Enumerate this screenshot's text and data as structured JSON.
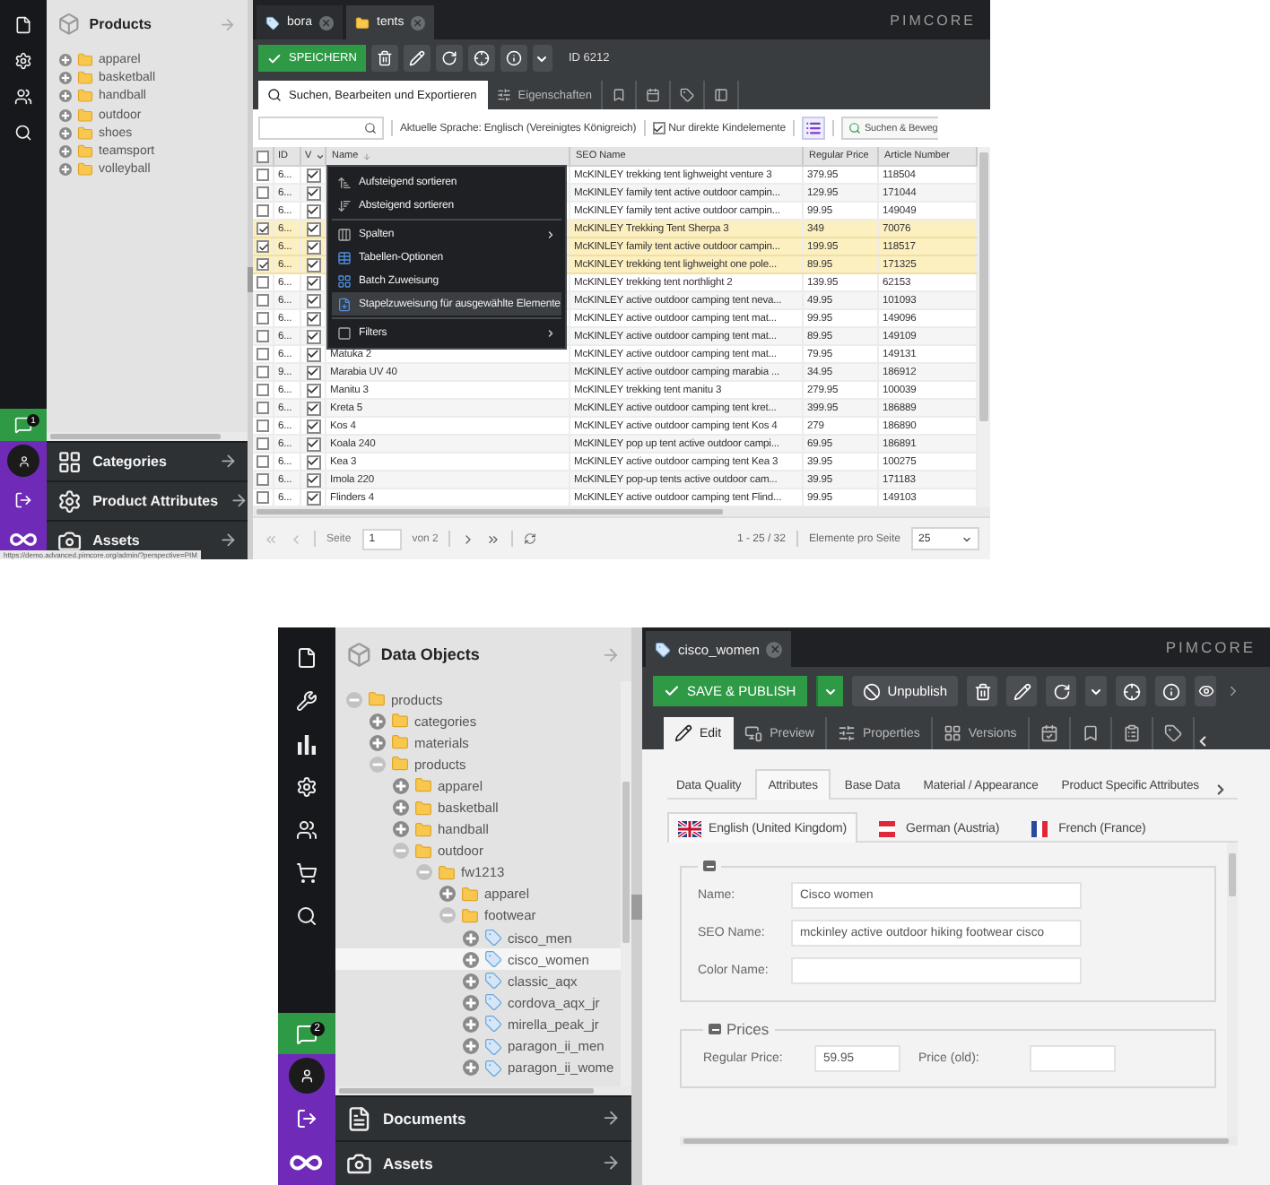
{
  "grid_view": {
    "rail": {
      "chat_badge": "1"
    },
    "tree_panel": {
      "title": "Products",
      "items": [
        {
          "label": "apparel",
          "kind": "folder",
          "expanded": false
        },
        {
          "label": "basketball",
          "kind": "folder",
          "expanded": false
        },
        {
          "label": "handball",
          "kind": "folder",
          "expanded": false
        },
        {
          "label": "outdoor",
          "kind": "folder",
          "expanded": false
        },
        {
          "label": "shoes",
          "kind": "folder",
          "expanded": false
        },
        {
          "label": "teamsport",
          "kind": "folder",
          "expanded": false
        },
        {
          "label": "volleyball",
          "kind": "folder",
          "expanded": false
        }
      ]
    },
    "accordions": [
      {
        "label": "Categories"
      },
      {
        "label": "Product Attributes"
      },
      {
        "label": "Assets"
      }
    ],
    "status_url": "https://demo.advanced.pimcore.org/admin/?perspective=PIM",
    "doc_tabs": [
      {
        "label": "bora",
        "kind": "object",
        "selected": false
      },
      {
        "label": "tents",
        "kind": "folder",
        "selected": true
      }
    ],
    "logo": "PIMCORE",
    "toolbar": {
      "save_label": "SPEICHERN",
      "id_label": "ID 6212"
    },
    "view_tabs": [
      {
        "label": "Suchen, Bearbeiten und Exportieren",
        "selected": true
      },
      {
        "label": "Eigenschaften",
        "selected": false
      },
      {
        "selected": false
      },
      {
        "selected": false
      },
      {
        "selected": false
      },
      {
        "selected": false
      }
    ],
    "filter_bar": {
      "language": "Aktuelle Sprache: Englisch (Vereinigtes Königreich)",
      "direct_children": {
        "label": "Nur direkte Kindelemente",
        "checked": true
      },
      "search_button": "Suchen & Beweg"
    },
    "table": {
      "all_checked": false,
      "columns": [
        "ID",
        "V",
        "Name",
        "SEO Name",
        "Regular Price",
        "Article Number"
      ],
      "rows": [
        {
          "checked": false,
          "selected": false,
          "id": "6...",
          "published": true,
          "seo_name": "McKINLEY trekking tent lighweight venture 3",
          "price": "379.95",
          "article": "118504"
        },
        {
          "checked": false,
          "selected": false,
          "id": "6...",
          "published": true,
          "seo_name": "McKINLEY family tent active outdoor campin...",
          "price": "129.95",
          "article": "171044"
        },
        {
          "checked": false,
          "selected": false,
          "id": "6...",
          "published": true,
          "seo_name": "McKINLEY family tent active outdoor campin...",
          "price": "99.95",
          "article": "149049"
        },
        {
          "checked": true,
          "selected": true,
          "id": "6...",
          "published": true,
          "seo_name": "McKINLEY Trekking Tent Sherpa 3",
          "price": "349",
          "article": "70076"
        },
        {
          "checked": true,
          "selected": true,
          "id": "6...",
          "published": true,
          "seo_name": "McKINLEY family tent active outdoor campin...",
          "price": "199.95",
          "article": "118517"
        },
        {
          "checked": true,
          "selected": true,
          "id": "6...",
          "published": true,
          "seo_name": "McKINLEY trekking tent lighweight one pole...",
          "price": "89.95",
          "article": "171325"
        },
        {
          "checked": false,
          "selected": false,
          "id": "6...",
          "published": true,
          "seo_name": "McKINLEY trekking tent northlight 2",
          "price": "139.95",
          "article": "62153"
        },
        {
          "checked": false,
          "selected": false,
          "id": "6...",
          "published": true,
          "seo_name": "McKINLEY active outdoor camping tent neva...",
          "price": "49.95",
          "article": "101093"
        },
        {
          "checked": false,
          "selected": false,
          "id": "6...",
          "published": true,
          "seo_name": "McKINLEY active outdoor camping tent mat...",
          "price": "99.95",
          "article": "149096"
        },
        {
          "checked": false,
          "selected": false,
          "id": "6...",
          "published": true,
          "seo_name": "McKINLEY active outdoor camping tent mat...",
          "price": "89.95",
          "article": "149109"
        },
        {
          "checked": false,
          "selected": false,
          "id": "6...",
          "published": true,
          "name": "Matuka 2",
          "seo_name": "McKINLEY active outdoor camping tent mat...",
          "price": "79.95",
          "article": "149131"
        },
        {
          "checked": false,
          "selected": false,
          "id": "9...",
          "published": true,
          "name": "Marabia UV 40",
          "seo_name": "McKINLEY active outdoor camping marabia ...",
          "price": "34.95",
          "article": "186912"
        },
        {
          "checked": false,
          "selected": false,
          "id": "6...",
          "published": true,
          "name": "Manitu 3",
          "seo_name": "McKINLEY trekking tent manitu 3",
          "price": "279.95",
          "article": "100039"
        },
        {
          "checked": false,
          "selected": false,
          "id": "6...",
          "published": true,
          "name": "Kreta 5",
          "seo_name": "McKINLEY active outdoor camping tent kret...",
          "price": "399.95",
          "article": "186889"
        },
        {
          "checked": false,
          "selected": false,
          "id": "6...",
          "published": true,
          "name": "Kos 4",
          "seo_name": "McKINLEY active outdoor camping tent Kos 4",
          "price": "279",
          "article": "186890"
        },
        {
          "checked": false,
          "selected": false,
          "id": "6...",
          "published": true,
          "name": "Koala 240",
          "seo_name": "McKINLEY pop up tent active outdoor campi...",
          "price": "69.95",
          "article": "186891"
        },
        {
          "checked": false,
          "selected": false,
          "id": "6...",
          "published": true,
          "name": "Kea 3",
          "seo_name": "McKINLEY active outdoor camping tent Kea 3",
          "price": "39.95",
          "article": "100275"
        },
        {
          "checked": false,
          "selected": false,
          "id": "6...",
          "published": true,
          "name": "Imola 220",
          "seo_name": "McKINLEY pop-up tents active outdoor cam...",
          "price": "39.95",
          "article": "171183"
        },
        {
          "checked": false,
          "selected": false,
          "id": "6...",
          "published": true,
          "name": "Flinders 4",
          "seo_name": "McKINLEY active outdoor camping tent Flind...",
          "price": "99.95",
          "article": "149103"
        }
      ]
    },
    "context_menu": {
      "items": [
        {
          "label": "Aufsteigend sortieren",
          "selected": false
        },
        {
          "label": "Absteigend sortieren",
          "selected": false
        },
        {
          "label": "Spalten",
          "submenu": true,
          "divider_before": true,
          "selected": false
        },
        {
          "label": "Tabellen-Optionen",
          "selected": false
        },
        {
          "label": "Batch Zuweisung",
          "selected": false
        },
        {
          "label": "Stapelzuweisung für ausgewählte Elemente",
          "selected": true
        },
        {
          "label": "Filters",
          "submenu": true,
          "divider_before": true,
          "selected": false
        }
      ]
    },
    "pager": {
      "page_label": "Seite",
      "page": "1",
      "of": "von 2",
      "range": "1 - 25 / 32",
      "per_page_label": "Elemente pro Seite",
      "per_page": "25"
    }
  },
  "object_editor": {
    "rail": {
      "chat_badge": "2"
    },
    "tree_panel": {
      "title": "Data Objects",
      "items": [
        {
          "label": "products",
          "kind": "folder",
          "expanded": true,
          "selected": false,
          "children": [
            {
              "label": "categories",
              "kind": "folder",
              "expanded": false,
              "selected": false
            },
            {
              "label": "materials",
              "kind": "folder",
              "expanded": false,
              "selected": false
            },
            {
              "label": "products",
              "kind": "folder",
              "expanded": true,
              "selected": false,
              "children": [
                {
                  "label": "apparel",
                  "kind": "folder",
                  "expanded": false,
                  "selected": false
                },
                {
                  "label": "basketball",
                  "kind": "folder",
                  "expanded": false,
                  "selected": false
                },
                {
                  "label": "handball",
                  "kind": "folder",
                  "expanded": false,
                  "selected": false
                },
                {
                  "label": "outdoor",
                  "kind": "folder",
                  "expanded": true,
                  "selected": false,
                  "children": [
                    {
                      "label": "fw1213",
                      "kind": "folder",
                      "expanded": true,
                      "selected": false,
                      "children": [
                        {
                          "label": "apparel",
                          "kind": "folder",
                          "expanded": false,
                          "selected": false
                        },
                        {
                          "label": "footwear",
                          "kind": "folder",
                          "expanded": true,
                          "selected": false,
                          "children": [
                            {
                              "label": "cisco_men",
                              "kind": "object",
                              "expanded": false,
                              "selected": false
                            },
                            {
                              "label": "cisco_women",
                              "kind": "object",
                              "expanded": false,
                              "selected": true
                            },
                            {
                              "label": "classic_aqx",
                              "kind": "object",
                              "expanded": false,
                              "selected": false
                            },
                            {
                              "label": "cordova_aqx_jr",
                              "kind": "object",
                              "expanded": false,
                              "selected": false
                            },
                            {
                              "label": "mirella_peak_jr",
                              "kind": "object",
                              "expanded": false,
                              "selected": false
                            },
                            {
                              "label": "paragon_ii_men",
                              "kind": "object",
                              "expanded": false,
                              "selected": false
                            },
                            {
                              "label": "paragon_ii_wome",
                              "kind": "object",
                              "expanded": false,
                              "selected": false
                            }
                          ]
                        }
                      ]
                    }
                  ]
                }
              ]
            }
          ]
        }
      ]
    },
    "accordions": [
      {
        "label": "Documents"
      },
      {
        "label": "Assets"
      }
    ],
    "doc_tabs": [
      {
        "label": "cisco_women",
        "kind": "object",
        "selected": true
      }
    ],
    "logo": "PIMCORE",
    "toolbar": {
      "publish_label": "SAVE & PUBLISH",
      "unpublish_label": "Unpublish"
    },
    "view_tabs": [
      {
        "label": "Edit",
        "selected": true
      },
      {
        "label": "Preview",
        "selected": false
      },
      {
        "label": "Properties",
        "selected": false
      },
      {
        "label": "Versions",
        "selected": false
      },
      {
        "selected": false
      },
      {
        "selected": false
      },
      {
        "selected": false
      },
      {
        "selected": false
      }
    ],
    "layout_tabs": [
      {
        "label": "Data Quality",
        "selected": false
      },
      {
        "label": "Attributes",
        "selected": true
      },
      {
        "label": "Base Data",
        "selected": false
      },
      {
        "label": "Material / Appearance",
        "selected": false
      },
      {
        "label": "Product Specific Attributes",
        "selected": false
      }
    ],
    "language_tabs": [
      {
        "label": "English (United Kingdom)",
        "selected": true
      },
      {
        "label": "German (Austria)",
        "selected": false
      },
      {
        "label": "French (France)",
        "selected": false
      }
    ],
    "fieldsets": [
      {
        "kind": "stacked",
        "fields": [
          {
            "label": "Name:",
            "value": "Cisco women"
          },
          {
            "label": "SEO Name:",
            "value": "mckinley active outdoor hiking footwear cisco"
          },
          {
            "label": "Color Name:"
          }
        ]
      },
      {
        "kind": "inline",
        "title": "Prices",
        "fields": [
          {
            "label": "Regular Price:",
            "value": "59.95"
          },
          {
            "label": "Price (old):"
          }
        ]
      }
    ]
  }
}
